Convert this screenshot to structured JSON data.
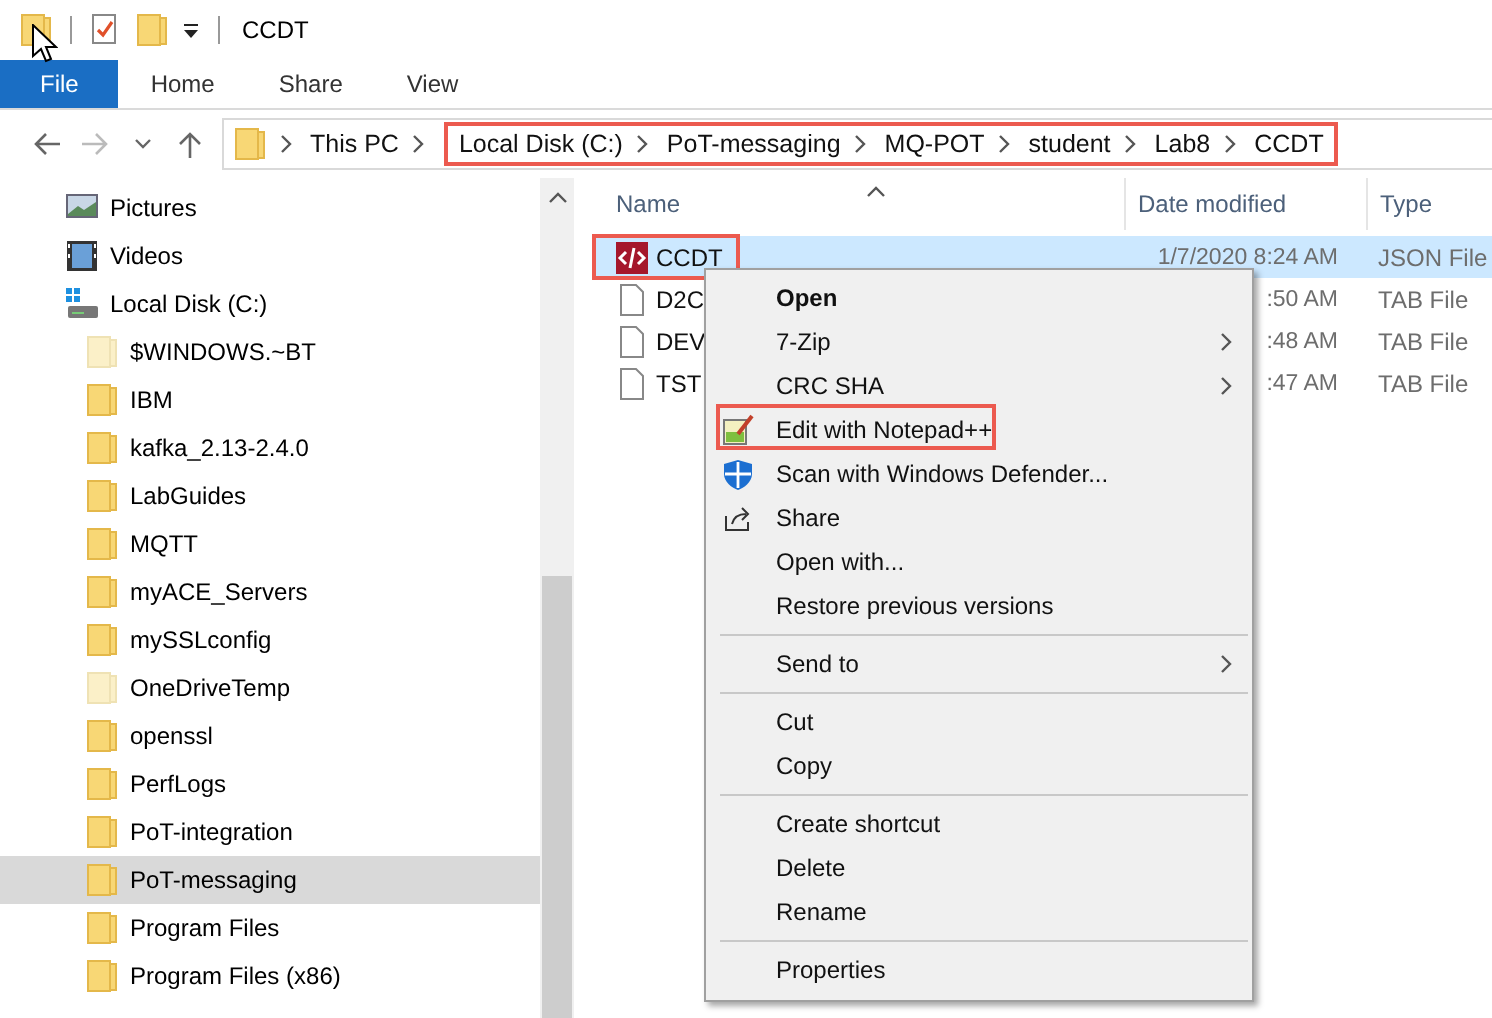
{
  "title_bar": {
    "title": "CCDT"
  },
  "ribbon": {
    "tabs": [
      {
        "label": "File",
        "selected": true
      },
      {
        "label": "Home",
        "selected": false
      },
      {
        "label": "Share",
        "selected": false
      },
      {
        "label": "View",
        "selected": false
      }
    ]
  },
  "address_bar": {
    "root": "This PC",
    "highlighted": true,
    "path": [
      "Local Disk (C:)",
      "PoT-messaging",
      "MQ-POT",
      "student",
      "Lab8",
      "CCDT"
    ]
  },
  "navigation_pane": {
    "items": [
      {
        "label": "Pictures",
        "kind": "pictures",
        "selected": false
      },
      {
        "label": "Videos",
        "kind": "videos",
        "selected": false
      },
      {
        "label": "Local Disk (C:)",
        "kind": "drive",
        "selected": false,
        "children": [
          {
            "label": "$WINDOWS.~BT",
            "kind": "folder",
            "hidden": true,
            "selected": false
          },
          {
            "label": "IBM",
            "kind": "folder",
            "hidden": false,
            "selected": false
          },
          {
            "label": "kafka_2.13-2.4.0",
            "kind": "folder",
            "hidden": false,
            "selected": false
          },
          {
            "label": "LabGuides",
            "kind": "folder",
            "hidden": false,
            "selected": false
          },
          {
            "label": "MQTT",
            "kind": "folder",
            "hidden": false,
            "selected": false
          },
          {
            "label": "myACE_Servers",
            "kind": "folder",
            "hidden": false,
            "selected": false
          },
          {
            "label": "mySSLconfig",
            "kind": "folder",
            "hidden": false,
            "selected": false
          },
          {
            "label": "OneDriveTemp",
            "kind": "folder",
            "hidden": true,
            "selected": false
          },
          {
            "label": "openssl",
            "kind": "folder",
            "hidden": false,
            "selected": false
          },
          {
            "label": "PerfLogs",
            "kind": "folder",
            "hidden": false,
            "selected": false
          },
          {
            "label": "PoT-integration",
            "kind": "folder",
            "hidden": false,
            "selected": false
          },
          {
            "label": "PoT-messaging",
            "kind": "folder",
            "hidden": false,
            "selected": true
          },
          {
            "label": "Program Files",
            "kind": "folder",
            "hidden": false,
            "selected": false
          },
          {
            "label": "Program Files (x86)",
            "kind": "folder",
            "hidden": false,
            "selected": false
          }
        ]
      }
    ]
  },
  "file_list": {
    "columns": [
      "Name",
      "Date modified",
      "Type"
    ],
    "rows": [
      {
        "name": "CCDT",
        "date": "1/7/2020 8:24 AM",
        "type": "JSON File",
        "kind": "json",
        "selected": true,
        "highlighted": true
      },
      {
        "name": "D2C",
        "date": ":50 AM",
        "type": "TAB File",
        "kind": "document",
        "selected": false,
        "highlighted": false
      },
      {
        "name": "DEV",
        "date": ":48 AM",
        "type": "TAB File",
        "kind": "document",
        "selected": false,
        "highlighted": false
      },
      {
        "name": "TST",
        "date": ":47 AM",
        "type": "TAB File",
        "kind": "document",
        "selected": false,
        "highlighted": false
      }
    ]
  },
  "context_menu": {
    "items": [
      {
        "kind": "item",
        "label": "Open",
        "default": true,
        "submenu": false,
        "highlighted": false
      },
      {
        "kind": "item",
        "label": "7-Zip",
        "default": false,
        "submenu": true,
        "highlighted": false
      },
      {
        "kind": "item",
        "label": "CRC SHA",
        "default": false,
        "submenu": true,
        "highlighted": false
      },
      {
        "kind": "item",
        "label": "Edit with Notepad++",
        "default": false,
        "submenu": false,
        "highlighted": true
      },
      {
        "kind": "item",
        "label": "Scan with Windows Defender...",
        "default": false,
        "submenu": false,
        "highlighted": false
      },
      {
        "kind": "item",
        "label": "Share",
        "default": false,
        "submenu": false,
        "highlighted": false
      },
      {
        "kind": "item",
        "label": "Open with...",
        "default": false,
        "submenu": false,
        "highlighted": false
      },
      {
        "kind": "item",
        "label": "Restore previous versions",
        "default": false,
        "submenu": false,
        "highlighted": false
      },
      {
        "kind": "separator"
      },
      {
        "kind": "item",
        "label": "Send to",
        "default": false,
        "submenu": true,
        "highlighted": false
      },
      {
        "kind": "separator"
      },
      {
        "kind": "item",
        "label": "Cut",
        "default": false,
        "submenu": false,
        "highlighted": false
      },
      {
        "kind": "item",
        "label": "Copy",
        "default": false,
        "submenu": false,
        "highlighted": false
      },
      {
        "kind": "separator"
      },
      {
        "kind": "item",
        "label": "Create shortcut",
        "default": false,
        "submenu": false,
        "highlighted": false
      },
      {
        "kind": "item",
        "label": "Delete",
        "default": false,
        "submenu": false,
        "highlighted": false
      },
      {
        "kind": "item",
        "label": "Rename",
        "default": false,
        "submenu": false,
        "highlighted": false
      },
      {
        "kind": "separator"
      },
      {
        "kind": "item",
        "label": "Properties",
        "default": false,
        "submenu": false,
        "highlighted": false
      }
    ]
  }
}
